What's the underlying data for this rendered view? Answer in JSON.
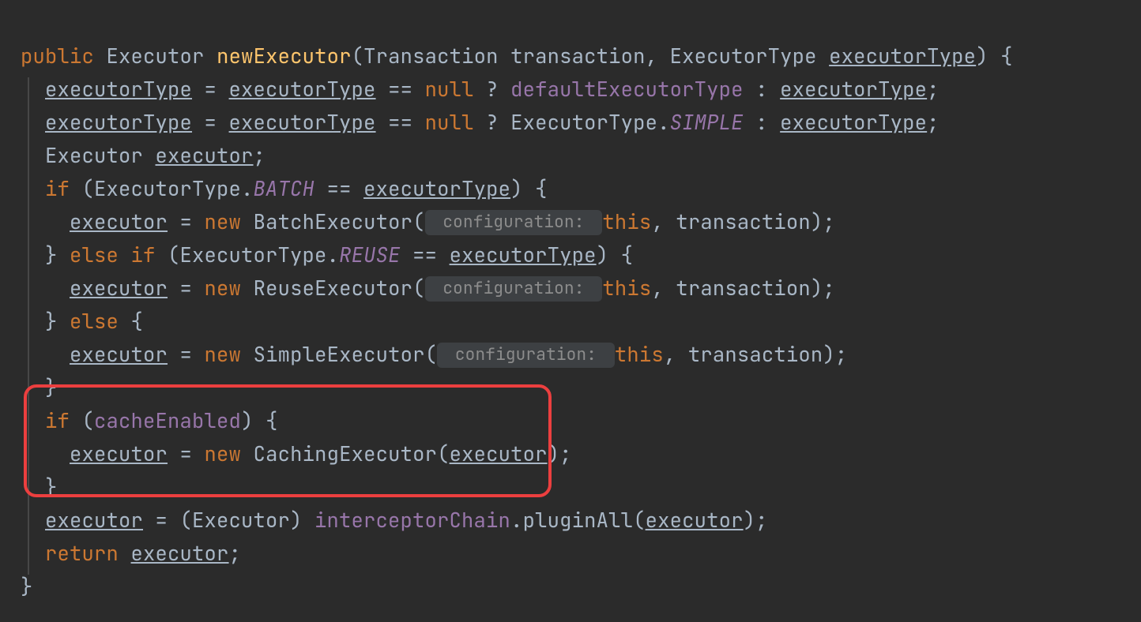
{
  "code": {
    "l1": {
      "public": "public",
      "Executor": "Executor",
      "newExecutor": "newExecutor",
      "lp": "(",
      "Transaction": "Transaction",
      "transaction": " transaction",
      "comma": ",",
      "ExecutorType": " ExecutorType ",
      "executorType": "executorType",
      "rp_brace": ") {"
    },
    "l2": {
      "executorType": "executorType",
      "eq": " = ",
      "executorType2": "executorType",
      "eqeq": " == ",
      "null": "null",
      "q": " ? ",
      "default": "defaultExecutorType",
      "colon": " : ",
      "executorType3": "executorType",
      "semi": ";"
    },
    "l3": {
      "executorType": "executorType",
      "eq": " = ",
      "executorType2": "executorType",
      "eqeq": " == ",
      "null": "null",
      "q": " ? ",
      "ExecutorType": "ExecutorType.",
      "SIMPLE": "SIMPLE",
      "colon": " : ",
      "executorType3": "executorType",
      "semi": ";"
    },
    "l4": {
      "Executor": "Executor ",
      "executor": "executor",
      "semi": ";"
    },
    "l5": {
      "if": "if",
      "lp": " (ExecutorType.",
      "BATCH": "BATCH",
      "eqeq": " == ",
      "executorType": "executorType",
      "rp_brace": ") {"
    },
    "l6": {
      "executor": "executor",
      "eq": " = ",
      "new": "new",
      "BatchExecutor": " BatchExecutor(",
      "hint": " configuration: ",
      "this": "this",
      "rest": ", transaction);"
    },
    "l7": {
      "rbrace": "} ",
      "else": "else if",
      "lp": " (ExecutorType.",
      "REUSE": "REUSE",
      "eqeq": " == ",
      "executorType": "executorType",
      "rp_brace": ") {"
    },
    "l8": {
      "executor": "executor",
      "eq": " = ",
      "new": "new",
      "ReuseExecutor": " ReuseExecutor(",
      "hint": " configuration: ",
      "this": "this",
      "rest": ", transaction);"
    },
    "l9": {
      "rbrace": "} ",
      "else": "else",
      "brace": " {"
    },
    "l10": {
      "executor": "executor",
      "eq": " = ",
      "new": "new",
      "SimpleExecutor": " SimpleExecutor(",
      "hint": " configuration: ",
      "this": "this",
      "rest": ", transaction);"
    },
    "l11": {
      "rbrace": "}"
    },
    "l12": {
      "if": "if",
      "lp": " (",
      "cacheEnabled": "cacheEnabled",
      "rp_brace": ") {"
    },
    "l13": {
      "executor": "executor",
      "eq": " = ",
      "new": "new",
      "CachingExecutor": " CachingExecutor(",
      "executor2": "executor",
      "rp_semi": ");"
    },
    "l14": {
      "rbrace": "}"
    },
    "l15": {
      "executor": "executor",
      "eq": " = (Executor) ",
      "chain": "interceptorChain",
      "dot": ".",
      "pluginAll": "pluginAll",
      "lp": "(",
      "executor2": "executor",
      "rp_semi": ");"
    },
    "l16": {
      "return": "return",
      "sp": " ",
      "executor": "executor",
      "semi": ";"
    },
    "l17": {
      "rbrace": "}"
    }
  }
}
